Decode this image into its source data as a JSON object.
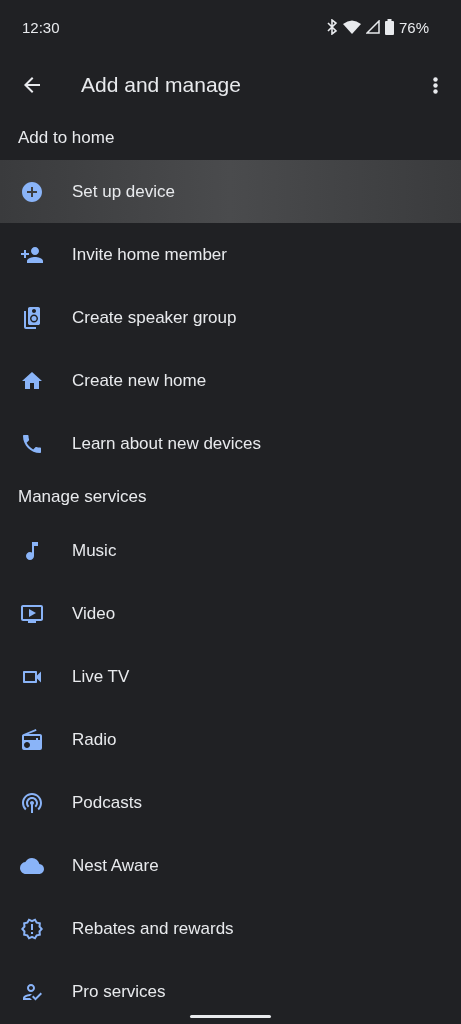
{
  "status_bar": {
    "time": "12:30",
    "battery": "76%"
  },
  "app_bar": {
    "title": "Add and manage"
  },
  "sections": [
    {
      "title": "Add to home",
      "items": [
        {
          "label": "Set up device",
          "selected": true
        },
        {
          "label": "Invite home member",
          "selected": false
        },
        {
          "label": "Create speaker group",
          "selected": false
        },
        {
          "label": "Create new home",
          "selected": false
        },
        {
          "label": "Learn about new devices",
          "selected": false
        }
      ]
    },
    {
      "title": "Manage services",
      "items": [
        {
          "label": "Music",
          "selected": false
        },
        {
          "label": "Video",
          "selected": false
        },
        {
          "label": "Live TV",
          "selected": false
        },
        {
          "label": "Radio",
          "selected": false
        },
        {
          "label": "Podcasts",
          "selected": false
        },
        {
          "label": "Nest Aware",
          "selected": false
        },
        {
          "label": "Rebates and rewards",
          "selected": false
        },
        {
          "label": "Pro services",
          "selected": false
        }
      ]
    }
  ]
}
